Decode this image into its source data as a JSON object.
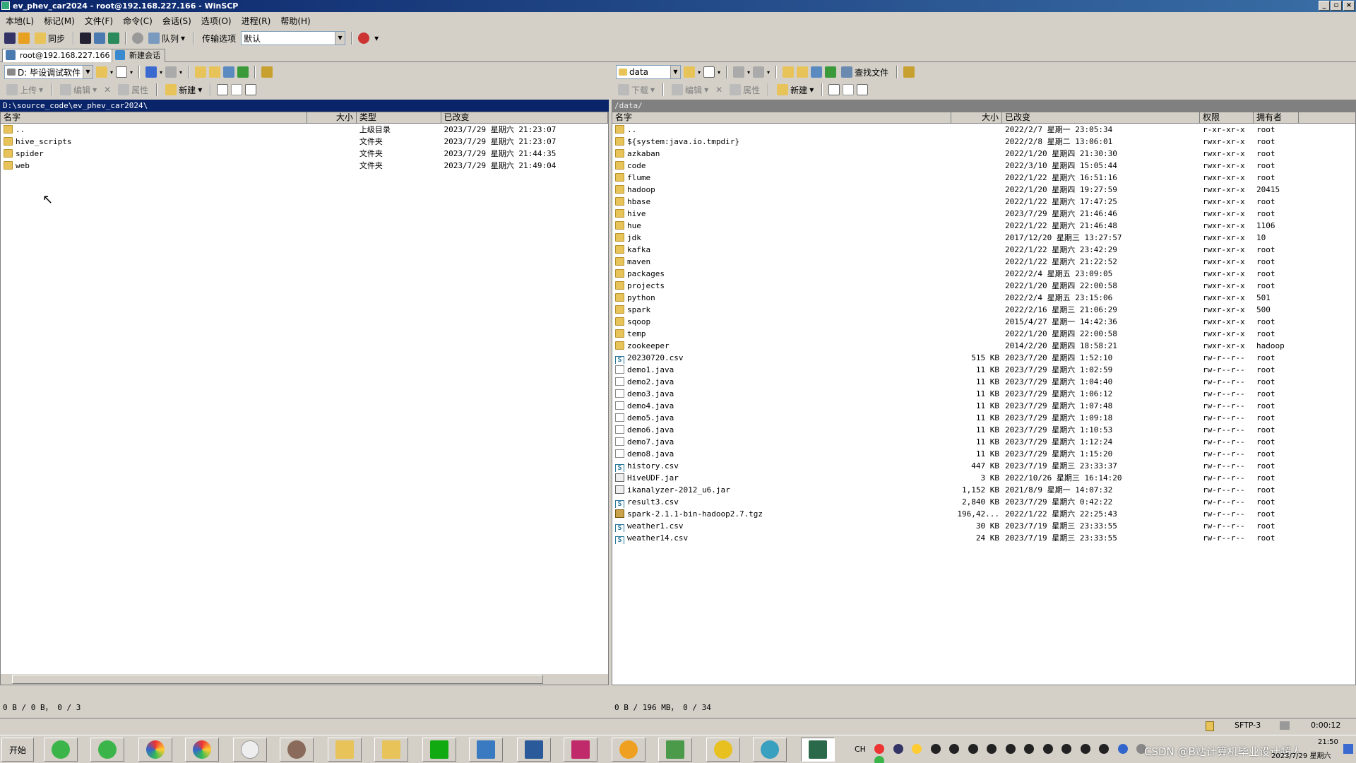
{
  "window": {
    "title": "ev_phev_car2024 - root@192.168.227.166 - WinSCP"
  },
  "menu": [
    "本地(L)",
    "标记(M)",
    "文件(F)",
    "命令(C)",
    "会话(S)",
    "选项(O)",
    "进程(R)",
    "帮助(H)"
  ],
  "toolbar": {
    "sync_label": "同步",
    "queue_label": "队列",
    "transfer_label": "传输选项",
    "transfer_value": "默认"
  },
  "tabs": [
    {
      "label": "root@192.168.227.166"
    },
    {
      "label": "新建会话"
    }
  ],
  "local": {
    "drive": "D: 毕设调试软件",
    "upload_label": "上传",
    "edit_label": "编辑",
    "props_label": "属性",
    "new_label": "新建",
    "path": "D:\\source_code\\ev_phev_car2024\\",
    "columns": {
      "name": "名字",
      "size": "大小",
      "type": "类型",
      "changed": "已改变"
    },
    "rows": [
      {
        "name": "..",
        "type": "上级目录",
        "changed": "2023/7/29 星期六  21:23:07",
        "icon": "up"
      },
      {
        "name": "hive_scripts",
        "type": "文件夹",
        "changed": "2023/7/29 星期六  21:23:07",
        "icon": "folder"
      },
      {
        "name": "spider",
        "type": "文件夹",
        "changed": "2023/7/29 星期六  21:44:35",
        "icon": "folder"
      },
      {
        "name": "web",
        "type": "文件夹",
        "changed": "2023/7/29 星期六  21:49:04",
        "icon": "folder"
      }
    ],
    "status": "0 B / 0 B，  0 / 3"
  },
  "remote": {
    "dir": "data",
    "find_label": "查找文件",
    "download_label": "下载",
    "edit_label": "编辑",
    "props_label": "属性",
    "new_label": "新建",
    "path": "/data/",
    "columns": {
      "name": "名字",
      "size": "大小",
      "changed": "已改变",
      "rights": "权限",
      "owner": "拥有者"
    },
    "rows": [
      {
        "name": "..",
        "size": "",
        "changed": "2022/2/7 星期一 23:05:34",
        "rights": "r-xr-xr-x",
        "owner": "root",
        "icon": "up"
      },
      {
        "name": "${system:java.io.tmpdir}",
        "size": "",
        "changed": "2022/2/8 星期二 13:06:01",
        "rights": "rwxr-xr-x",
        "owner": "root",
        "icon": "folder"
      },
      {
        "name": "azkaban",
        "size": "",
        "changed": "2022/1/20 星期四 21:30:30",
        "rights": "rwxr-xr-x",
        "owner": "root",
        "icon": "folder"
      },
      {
        "name": "code",
        "size": "",
        "changed": "2022/3/10 星期四 15:05:44",
        "rights": "rwxr-xr-x",
        "owner": "root",
        "icon": "folder"
      },
      {
        "name": "flume",
        "size": "",
        "changed": "2022/1/22 星期六 16:51:16",
        "rights": "rwxr-xr-x",
        "owner": "root",
        "icon": "folder"
      },
      {
        "name": "hadoop",
        "size": "",
        "changed": "2022/1/20 星期四 19:27:59",
        "rights": "rwxr-xr-x",
        "owner": "20415",
        "icon": "folder"
      },
      {
        "name": "hbase",
        "size": "",
        "changed": "2022/1/22 星期六 17:47:25",
        "rights": "rwxr-xr-x",
        "owner": "root",
        "icon": "folder"
      },
      {
        "name": "hive",
        "size": "",
        "changed": "2023/7/29 星期六 21:46:46",
        "rights": "rwxr-xr-x",
        "owner": "root",
        "icon": "folder"
      },
      {
        "name": "hue",
        "size": "",
        "changed": "2022/1/22 星期六 21:46:48",
        "rights": "rwxr-xr-x",
        "owner": "1106",
        "icon": "folder"
      },
      {
        "name": "jdk",
        "size": "",
        "changed": "2017/12/20 星期三 13:27:57",
        "rights": "rwxr-xr-x",
        "owner": "10",
        "icon": "folder"
      },
      {
        "name": "kafka",
        "size": "",
        "changed": "2022/1/22 星期六 23:42:29",
        "rights": "rwxr-xr-x",
        "owner": "root",
        "icon": "folder"
      },
      {
        "name": "maven",
        "size": "",
        "changed": "2022/1/22 星期六 21:22:52",
        "rights": "rwxr-xr-x",
        "owner": "root",
        "icon": "folder"
      },
      {
        "name": "packages",
        "size": "",
        "changed": "2022/2/4 星期五 23:09:05",
        "rights": "rwxr-xr-x",
        "owner": "root",
        "icon": "folder"
      },
      {
        "name": "projects",
        "size": "",
        "changed": "2022/1/20 星期四 22:00:58",
        "rights": "rwxr-xr-x",
        "owner": "root",
        "icon": "folder"
      },
      {
        "name": "python",
        "size": "",
        "changed": "2022/2/4 星期五 23:15:06",
        "rights": "rwxr-xr-x",
        "owner": "501",
        "icon": "folder"
      },
      {
        "name": "spark",
        "size": "",
        "changed": "2022/2/16 星期三 21:06:29",
        "rights": "rwxr-xr-x",
        "owner": "500",
        "icon": "folder"
      },
      {
        "name": "sqoop",
        "size": "",
        "changed": "2015/4/27 星期一 14:42:36",
        "rights": "rwxr-xr-x",
        "owner": "root",
        "icon": "folder"
      },
      {
        "name": "temp",
        "size": "",
        "changed": "2022/1/20 星期四 22:00:58",
        "rights": "rwxr-xr-x",
        "owner": "root",
        "icon": "folder"
      },
      {
        "name": "zookeeper",
        "size": "",
        "changed": "2014/2/20 星期四 18:58:21",
        "rights": "rwxr-xr-x",
        "owner": "hadoop",
        "icon": "folder"
      },
      {
        "name": "20230720.csv",
        "size": "515 KB",
        "changed": "2023/7/20 星期四 1:52:10",
        "rights": "rw-r--r--",
        "owner": "root",
        "icon": "csv"
      },
      {
        "name": "demo1.java",
        "size": "11 KB",
        "changed": "2023/7/29 星期六 1:02:59",
        "rights": "rw-r--r--",
        "owner": "root",
        "icon": "file"
      },
      {
        "name": "demo2.java",
        "size": "11 KB",
        "changed": "2023/7/29 星期六 1:04:40",
        "rights": "rw-r--r--",
        "owner": "root",
        "icon": "file"
      },
      {
        "name": "demo3.java",
        "size": "11 KB",
        "changed": "2023/7/29 星期六 1:06:12",
        "rights": "rw-r--r--",
        "owner": "root",
        "icon": "file"
      },
      {
        "name": "demo4.java",
        "size": "11 KB",
        "changed": "2023/7/29 星期六 1:07:48",
        "rights": "rw-r--r--",
        "owner": "root",
        "icon": "file"
      },
      {
        "name": "demo5.java",
        "size": "11 KB",
        "changed": "2023/7/29 星期六 1:09:18",
        "rights": "rw-r--r--",
        "owner": "root",
        "icon": "file"
      },
      {
        "name": "demo6.java",
        "size": "11 KB",
        "changed": "2023/7/29 星期六 1:10:53",
        "rights": "rw-r--r--",
        "owner": "root",
        "icon": "file"
      },
      {
        "name": "demo7.java",
        "size": "11 KB",
        "changed": "2023/7/29 星期六 1:12:24",
        "rights": "rw-r--r--",
        "owner": "root",
        "icon": "file"
      },
      {
        "name": "demo8.java",
        "size": "11 KB",
        "changed": "2023/7/29 星期六 1:15:20",
        "rights": "rw-r--r--",
        "owner": "root",
        "icon": "file"
      },
      {
        "name": "history.csv",
        "size": "447 KB",
        "changed": "2023/7/19 星期三 23:33:37",
        "rights": "rw-r--r--",
        "owner": "root",
        "icon": "csv"
      },
      {
        "name": "HiveUDF.jar",
        "size": "3 KB",
        "changed": "2022/10/26 星期三 16:14:20",
        "rights": "rw-r--r--",
        "owner": "root",
        "icon": "jar"
      },
      {
        "name": "ikanalyzer-2012_u6.jar",
        "size": "1,152 KB",
        "changed": "2021/8/9 星期一 14:07:32",
        "rights": "rw-r--r--",
        "owner": "root",
        "icon": "jar"
      },
      {
        "name": "result3.csv",
        "size": "2,840 KB",
        "changed": "2023/7/29 星期六 0:42:22",
        "rights": "rw-r--r--",
        "owner": "root",
        "icon": "csv"
      },
      {
        "name": "spark-2.1.1-bin-hadoop2.7.tgz",
        "size": "196,42...",
        "changed": "2022/1/22 星期六 22:25:43",
        "rights": "rw-r--r--",
        "owner": "root",
        "icon": "tgz"
      },
      {
        "name": "weather1.csv",
        "size": "30 KB",
        "changed": "2023/7/19 星期三 23:33:55",
        "rights": "rw-r--r--",
        "owner": "root",
        "icon": "csv"
      },
      {
        "name": "weather14.csv",
        "size": "24 KB",
        "changed": "2023/7/19 星期三 23:33:55",
        "rights": "rw-r--r--",
        "owner": "root",
        "icon": "csv"
      }
    ],
    "status": "0 B / 196 MB，  0 / 34"
  },
  "statusbar": {
    "protocol": "SFTP-3",
    "elapsed": "0:00:12"
  },
  "taskbar": {
    "start_label": "开始",
    "lang": "CH",
    "watermark": "CSDN @B站计算机毕业设计超人",
    "time": "21:50",
    "date": "2023/7/29 星期六"
  },
  "colors": {
    "title_start": "#0a246a",
    "title_end": "#3a6ea5",
    "chrome": "#d4d0c8",
    "folder": "#e8c35a"
  }
}
